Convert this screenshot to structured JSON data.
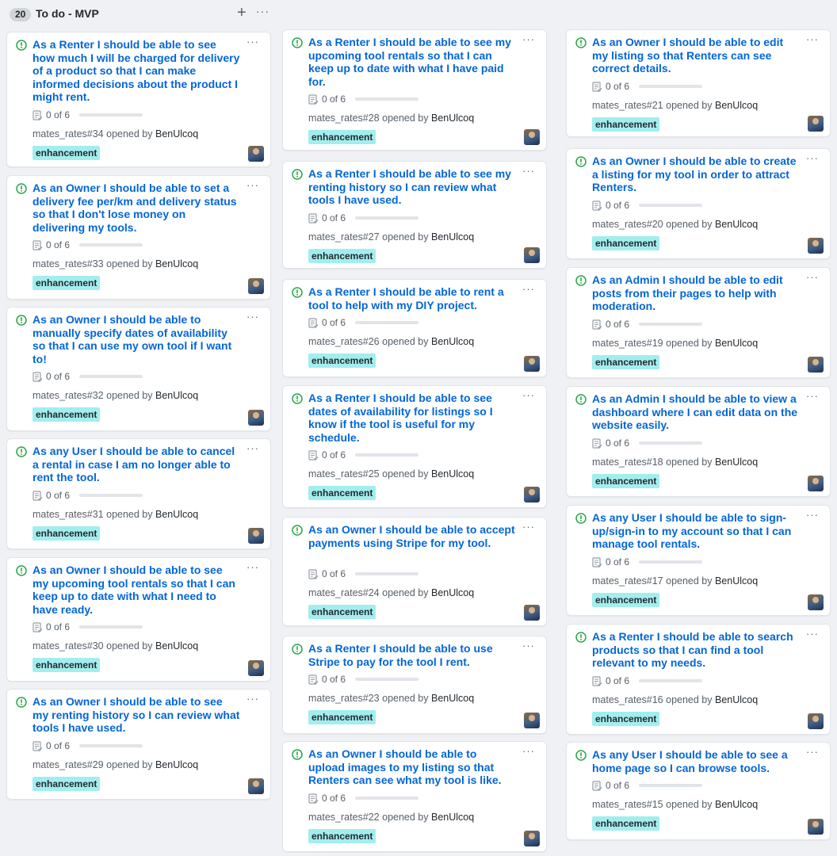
{
  "column": {
    "count": "20",
    "title": "To do - MVP",
    "add_label": "+",
    "more_label": "···"
  },
  "card_common": {
    "progress": "0 of 6",
    "opened_by": "opened by",
    "author": "BenUlcoq",
    "label": "enhancement",
    "more": "···",
    "label_color": "#a2eeef",
    "title_color": "#0366d6",
    "issue_icon_color": "#28a745"
  },
  "cards": [
    {
      "title": "As a Renter I should be able to see how much I will be charged for delivery of a product so that I can make informed decisions about the product I might rent.",
      "ref": "mates_rates#34"
    },
    {
      "title": "As an Owner I should be able to set a delivery fee per/km and delivery status so that I don't lose money on delivering my tools.",
      "ref": "mates_rates#33"
    },
    {
      "title": "As an Owner I should be able to manually specify dates of availability so that I can use my own tool if I want to!",
      "ref": "mates_rates#32"
    },
    {
      "title": "As any User I should be able to cancel a rental in case I am no longer able to rent the tool.",
      "ref": "mates_rates#31"
    },
    {
      "title": "As an Owner I should be able to see my upcoming tool rentals so that I can keep up to date with what I need to have ready.",
      "ref": "mates_rates#30"
    },
    {
      "title": "As an Owner I should be able to see my renting history so I can review what tools I have used.",
      "ref": "mates_rates#29"
    },
    {
      "title": "As a Renter I should be able to see my upcoming tool rentals so that I can keep up to date with what I have paid for.",
      "ref": "mates_rates#28"
    },
    {
      "title": "As a Renter I should be able to see my renting history so I can review what tools I have used.",
      "ref": "mates_rates#27"
    },
    {
      "title": "As a Renter I should be able to rent a tool to help with my DIY project.",
      "ref": "mates_rates#26"
    },
    {
      "title": "As a Renter I should be able to see dates of availability for listings so I know if the tool is useful for my schedule.",
      "ref": "mates_rates#25"
    },
    {
      "title": "As an Owner I should be able to accept payments using Stripe for my tool.",
      "ref": "mates_rates#24"
    },
    {
      "title": "As a Renter I should be able to use Stripe to pay for the tool I rent.",
      "ref": "mates_rates#23"
    },
    {
      "title": "As an Owner I should be able to upload images to my listing so that Renters can see what my tool is like.",
      "ref": "mates_rates#22"
    },
    {
      "title": "As an Owner I should be able to edit my listing so that Renters can see correct details.",
      "ref": "mates_rates#21"
    },
    {
      "title": "As an Owner I should be able to create a listing for my tool in order to attract Renters.",
      "ref": "mates_rates#20"
    },
    {
      "title": "As an Admin I should be able to edit posts from their pages to help with moderation.",
      "ref": "mates_rates#19"
    },
    {
      "title": "As an Admin I should be able to view a dashboard where I can edit data on the website easily.",
      "ref": "mates_rates#18"
    },
    {
      "title": "As any User I should be able to sign-up/sign-in to my account so that I can manage tool rentals.",
      "ref": "mates_rates#17"
    },
    {
      "title": "As a Renter I should be able to search products so that I can find a tool relevant to my needs.",
      "ref": "mates_rates#16"
    },
    {
      "title": "As any User I should be able to see a home page so I can browse tools.",
      "ref": "mates_rates#15"
    }
  ]
}
